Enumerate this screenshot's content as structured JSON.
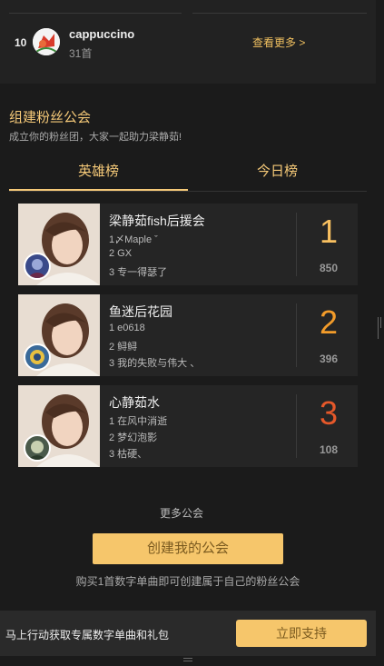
{
  "top_rank": {
    "rank": "10",
    "name": "cappuccino",
    "count": "31首",
    "more_link": "查看更多 >"
  },
  "guild": {
    "title": "组建粉丝公会",
    "subtitle": "成立你的粉丝团，大家一起助力梁静茹!",
    "tabs": [
      {
        "label": "英雄榜",
        "active": true
      },
      {
        "label": "今日榜",
        "active": false
      }
    ],
    "cards": [
      {
        "name": "梁静茹fish后援会",
        "members": [
          "1〆Maple ˇ",
          "2 GX",
          "3 专一得瑟了"
        ],
        "rank": "1",
        "score": "850",
        "rank_color": "#f8c060"
      },
      {
        "name": "鱼迷后花园",
        "members": [
          "1 e0618",
          "2 鲟鲟",
          "3 我的失败与伟大 、"
        ],
        "rank": "2",
        "score": "396",
        "rank_color": "#f39c2a"
      },
      {
        "name": "心静茹水",
        "members": [
          "1 在风中消逝",
          "2 梦幻泡影",
          "3 枯硬、"
        ],
        "rank": "3",
        "score": "108",
        "rank_color": "#e5582a"
      }
    ],
    "more_guilds": "更多公会",
    "create_button": "创建我的公会",
    "create_note": "购买1首数字单曲即可创建属于自己的粉丝公会"
  },
  "bottom_bar": {
    "text": "马上行动获取专属数字单曲和礼包",
    "support_button": "立即支持"
  },
  "colors": {
    "accent": "#f6c66b",
    "background": "#1b1b1b"
  }
}
